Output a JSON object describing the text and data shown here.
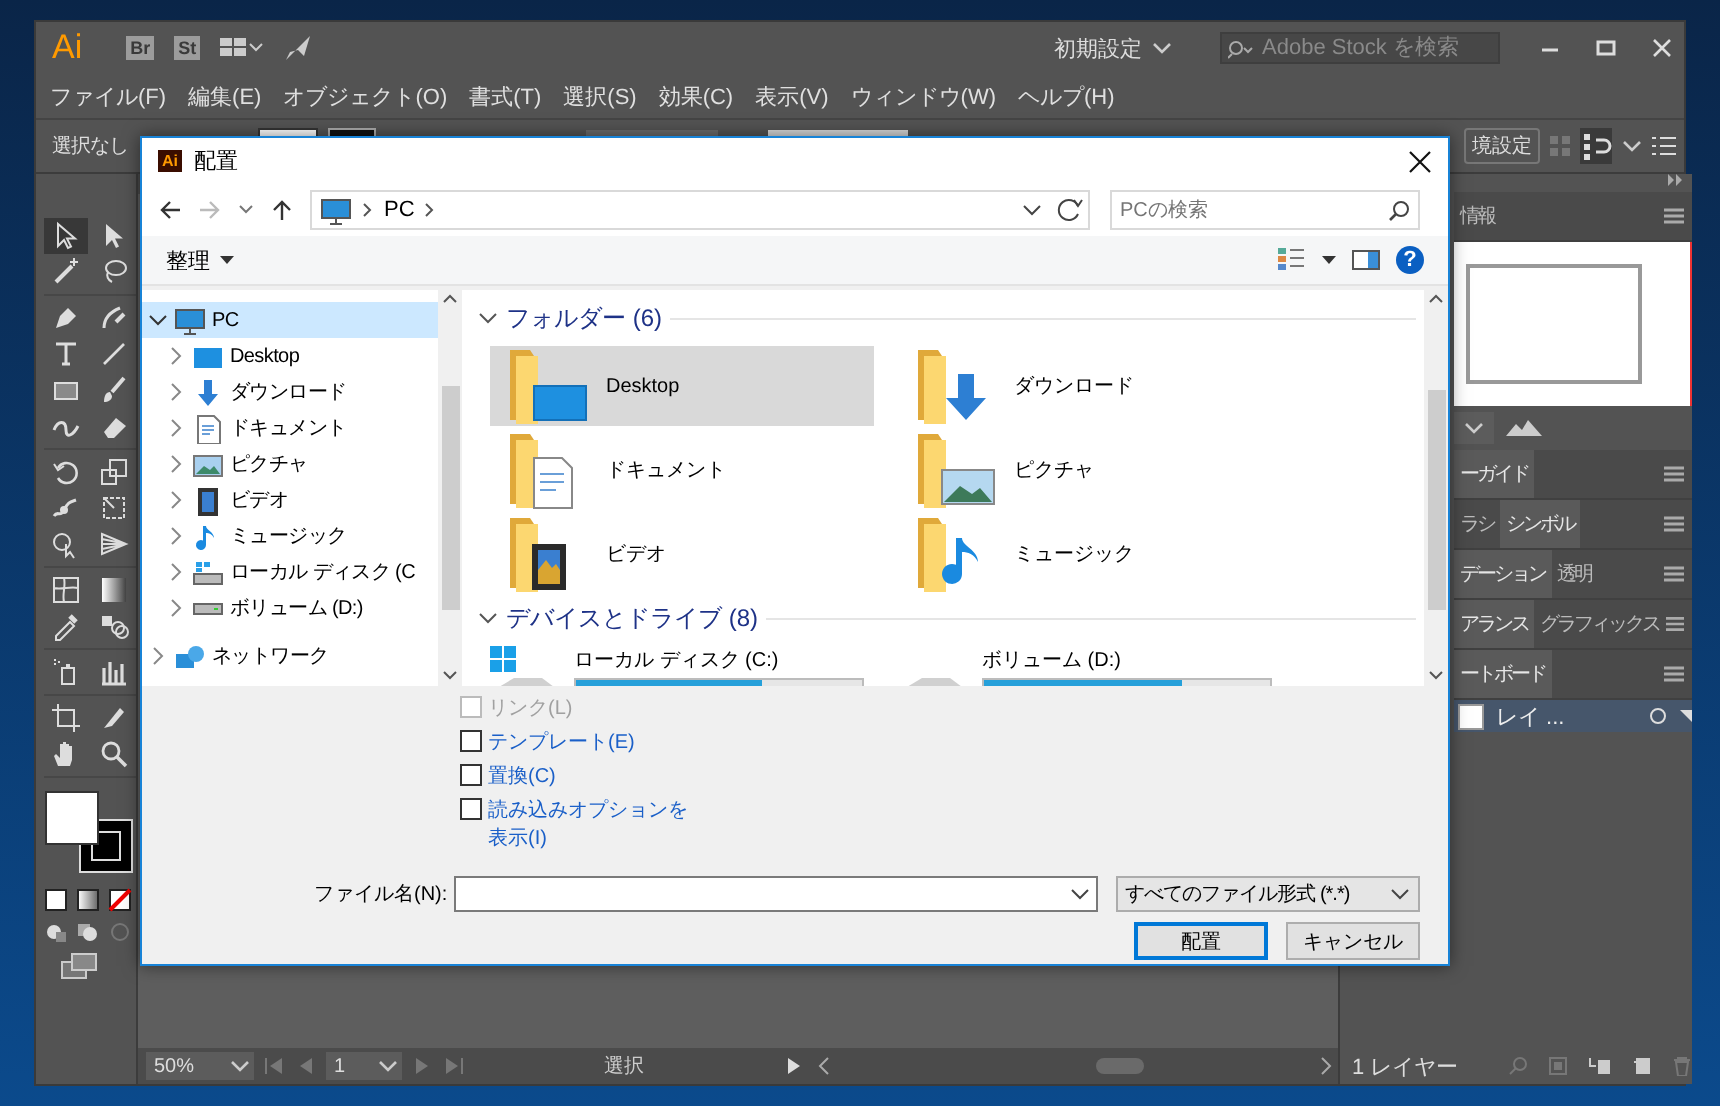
{
  "app": {
    "logo": "Ai",
    "bridge": "Br",
    "stock": "St",
    "workspace": "初期設定",
    "stock_search": {
      "placeholder": "Adobe Stock を検索"
    },
    "menu": [
      "ファイル(F)",
      "編集(E)",
      "オブジェクト(O)",
      "書式(T)",
      "選択(S)",
      "効果(C)",
      "表示(V)",
      "ウィンドウ(W)",
      "ヘルプ(H)"
    ],
    "control_bar": {
      "selection": "選択なし",
      "preferences_button": "境設定"
    }
  },
  "tool_groups": [
    {
      "tools": [
        {
          "kind": "selection",
          "selected": true
        },
        {
          "kind": "direct",
          "selected": false
        },
        {
          "kind": "wand",
          "selected": false
        },
        {
          "kind": "lasso",
          "selected": false
        }
      ]
    },
    {
      "tools": [
        {
          "kind": "pen",
          "selected": false
        },
        {
          "kind": "curvature",
          "selected": false
        },
        {
          "kind": "type",
          "selected": false
        },
        {
          "kind": "line",
          "selected": false
        },
        {
          "kind": "rect",
          "selected": false
        },
        {
          "kind": "brush",
          "selected": false
        },
        {
          "kind": "shaper",
          "selected": false
        },
        {
          "kind": "eraser",
          "selected": false
        }
      ]
    },
    {
      "tools": [
        {
          "kind": "rotate",
          "selected": false
        },
        {
          "kind": "scale",
          "selected": false
        },
        {
          "kind": "warp",
          "selected": false
        },
        {
          "kind": "transform",
          "selected": false
        },
        {
          "kind": "builder",
          "selected": false
        },
        {
          "kind": "perspective",
          "selected": false
        }
      ]
    },
    {
      "tools": [
        {
          "kind": "mesh",
          "selected": false
        },
        {
          "kind": "gradient",
          "selected": false
        },
        {
          "kind": "eyedropper",
          "selected": false
        },
        {
          "kind": "blend",
          "selected": false
        }
      ]
    },
    {
      "tools": [
        {
          "kind": "sprayer",
          "selected": false
        },
        {
          "kind": "graph",
          "selected": false
        }
      ]
    },
    {
      "tools": [
        {
          "kind": "artboard",
          "selected": false
        },
        {
          "kind": "slice",
          "selected": false
        },
        {
          "kind": "hand",
          "selected": false
        },
        {
          "kind": "zoom",
          "selected": false
        }
      ]
    }
  ],
  "panels": {
    "top_tab": {
      "label": "情報",
      "selected": false
    },
    "rows": [
      {
        "tabs": [
          {
            "label": "ーガイド",
            "selected": true
          }
        ]
      },
      {
        "tabs": [
          {
            "label": "ラシ",
            "selected": false
          },
          {
            "label": "シンボル",
            "selected": true
          }
        ]
      },
      {
        "tabs": [
          {
            "label": "デーション",
            "selected": true
          },
          {
            "label": "透明",
            "selected": false
          }
        ]
      },
      {
        "tabs": [
          {
            "label": "アランス",
            "selected": true
          },
          {
            "label": "グラフィックス",
            "selected": false
          }
        ]
      },
      {
        "tabs": [
          {
            "label": "ートボード",
            "selected": true
          }
        ]
      }
    ],
    "layers": {
      "items": [
        {
          "name": "レイ ...",
          "selected": true
        }
      ],
      "count": "1 レイヤー"
    }
  },
  "status_bar": {
    "zoom": "50%",
    "artboard": "1",
    "tool": "選択"
  },
  "dialog": {
    "badge": "Ai",
    "title": "配置",
    "address": [
      "PC"
    ],
    "search": {
      "placeholder": "PCの検索"
    },
    "organize": "整理",
    "help": "?",
    "tree": [
      {
        "label": "PC",
        "kind": "pc",
        "selected": true,
        "expanded": true,
        "children": [
          {
            "label": "Desktop",
            "kind": "desktop",
            "selected": false,
            "expanded": false
          },
          {
            "label": "ダウンロード",
            "kind": "downloads",
            "selected": false,
            "expanded": false
          },
          {
            "label": "ドキュメント",
            "kind": "documents",
            "selected": false,
            "expanded": false
          },
          {
            "label": "ピクチャ",
            "kind": "pictures",
            "selected": false,
            "expanded": false
          },
          {
            "label": "ビデオ",
            "kind": "videos",
            "selected": false,
            "expanded": false
          },
          {
            "label": "ミュージック",
            "kind": "music",
            "selected": false,
            "expanded": false
          },
          {
            "label": "ローカル ディスク (C",
            "kind": "system",
            "selected": false,
            "expanded": false
          },
          {
            "label": "ボリューム (D:)",
            "kind": "drive",
            "selected": false,
            "expanded": false
          }
        ]
      },
      {
        "label": "ネットワーク",
        "kind": "network",
        "selected": false,
        "expanded": false
      }
    ],
    "folders": {
      "title": "フォルダー (6)",
      "expanded": true,
      "items": [
        {
          "label": "Desktop",
          "kind": "desktop",
          "selected": true
        },
        {
          "label": "ダウンロード",
          "kind": "downloads",
          "selected": false
        },
        {
          "label": "ドキュメント",
          "kind": "documents",
          "selected": false
        },
        {
          "label": "ピクチャ",
          "kind": "pictures",
          "selected": false
        },
        {
          "label": "ビデオ",
          "kind": "videos",
          "selected": false
        },
        {
          "label": "ミュージック",
          "kind": "music",
          "selected": false
        }
      ]
    },
    "drives": {
      "title": "デバイスとドライブ (8)",
      "expanded": true,
      "items": [
        {
          "label": "ローカル ディスク (C:)",
          "kind": "system",
          "level": 0.65
        },
        {
          "label": "ボリューム (D:)",
          "kind": "drive",
          "level": 0.69
        }
      ]
    },
    "options": [
      {
        "label": "リンク(L)",
        "checked": false,
        "disabled": true
      },
      {
        "label": "テンプレート(E)",
        "checked": false,
        "disabled": false
      },
      {
        "label": "置換(C)",
        "checked": false,
        "disabled": false
      },
      {
        "label": "読み込みオプションを表示(I)",
        "checked": false,
        "disabled": false
      }
    ],
    "file_name_label": "ファイル名(N):",
    "file_type": "すべてのファイル形式 (*.*)",
    "buttons": [
      {
        "label": "配置",
        "default": true
      },
      {
        "label": "キャンセル",
        "default": false
      }
    ]
  }
}
